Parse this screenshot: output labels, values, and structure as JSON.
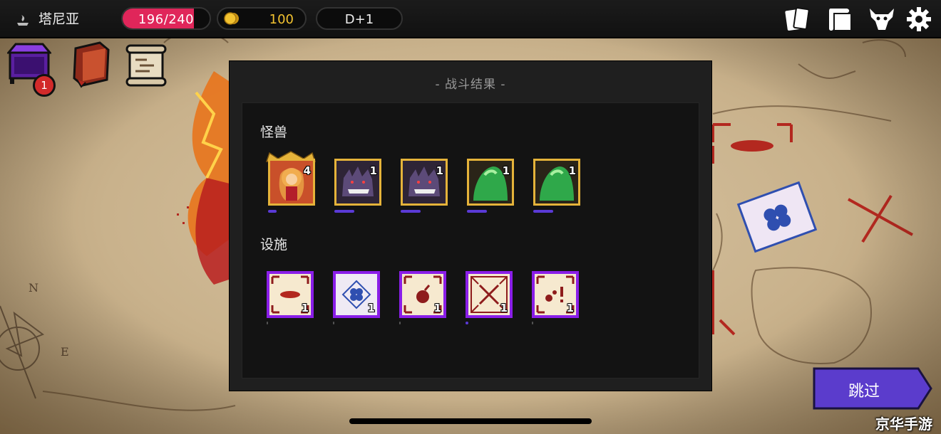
{
  "topbar": {
    "region_name": "塔尼亚",
    "hp": {
      "current": 196,
      "max": 240,
      "label": "196/240"
    },
    "gold": "100",
    "day": "D+1",
    "icons": [
      "cards-icon",
      "scroll-book-icon",
      "demon-mask-icon",
      "gear-icon"
    ]
  },
  "inventory": {
    "items": [
      "purple-chest-icon",
      "spellbook-icon",
      "map-scroll-icon"
    ],
    "badge": "1"
  },
  "result": {
    "title": "- 战斗结果 -",
    "monsters_label": "怪兽",
    "facilities_label": "设施",
    "monsters": [
      {
        "icon": "warrior-girl-icon",
        "count": "4",
        "crown": true,
        "frame": "gold"
      },
      {
        "icon": "purple-beast-icon",
        "count": "1",
        "frame": "gold"
      },
      {
        "icon": "purple-beast-icon",
        "count": "1",
        "frame": "gold"
      },
      {
        "icon": "green-slime-icon",
        "count": "1",
        "frame": "gold"
      },
      {
        "icon": "green-slime-icon",
        "count": "1",
        "frame": "gold"
      }
    ],
    "facilities": [
      {
        "icon": "blood-trap-tile-icon",
        "count": "1"
      },
      {
        "icon": "clover-tile-icon",
        "count": "1"
      },
      {
        "icon": "bomb-tile-icon",
        "count": "1"
      },
      {
        "icon": "crossed-swords-tile-icon",
        "count": "1"
      },
      {
        "icon": "scatter-tile-icon",
        "count": "1"
      }
    ]
  },
  "skip_label": "跳过",
  "watermark": "京华手游",
  "colors": {
    "hp": "#e0265a",
    "gold": "#f2c230",
    "skip": "#5b3ccc",
    "facility_frame": "#8a1ee8",
    "monster_frame": "#e5b33a"
  }
}
